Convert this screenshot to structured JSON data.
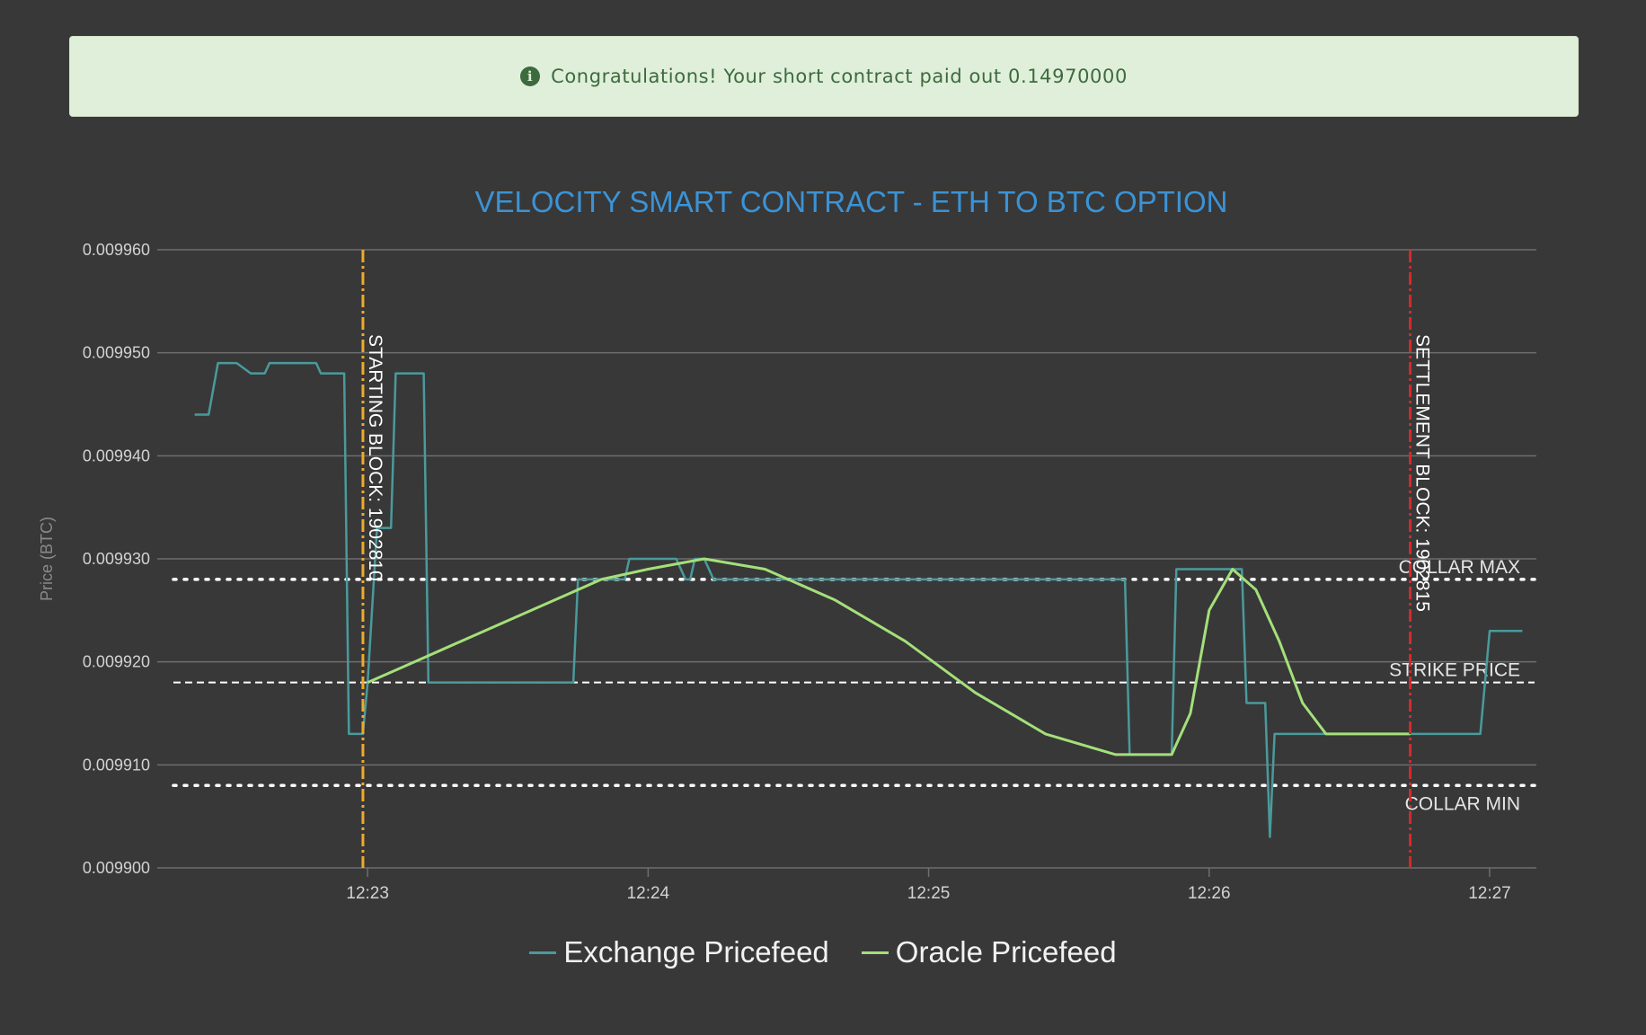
{
  "alert": {
    "icon": "info-icon",
    "message": "Congratulations! Your short contract paid out 0.14970000",
    "text_color": "#3c6b3e",
    "background": "#e0efda"
  },
  "chart_data": {
    "type": "line",
    "title": "VELOCITY SMART CONTRACT - ETH TO BTC OPTION",
    "xlabel": "",
    "ylabel": "Price (BTC)",
    "ylim": [
      0.0099,
      0.00996
    ],
    "xlim": [
      "12:22:15",
      "12:27:10"
    ],
    "y_ticks": [
      "0.009900",
      "0.009910",
      "0.009920",
      "0.009930",
      "0.009940",
      "0.009950",
      "0.009960"
    ],
    "x_ticks": [
      "12:23",
      "12:24",
      "12:25",
      "12:26",
      "12:27"
    ],
    "grid": true,
    "legend_position": "bottom",
    "series": [
      {
        "name": "Exchange Pricefeed",
        "color": "#4a9a9c",
        "points": [
          [
            "12:22:23",
            0.009944
          ],
          [
            "12:22:26",
            0.009944
          ],
          [
            "12:22:28",
            0.009949
          ],
          [
            "12:22:32",
            0.009949
          ],
          [
            "12:22:35",
            0.009948
          ],
          [
            "12:22:38",
            0.009948
          ],
          [
            "12:22:39",
            0.009949
          ],
          [
            "12:22:49",
            0.009949
          ],
          [
            "12:22:50",
            0.009948
          ],
          [
            "12:22:55",
            0.009948
          ],
          [
            "12:22:56",
            0.009913
          ],
          [
            "12:22:59",
            0.009913
          ],
          [
            "12:23:00",
            0.009918
          ],
          [
            "12:23:02",
            0.009933
          ],
          [
            "12:23:05",
            0.009933
          ],
          [
            "12:23:06",
            0.009948
          ],
          [
            "12:23:12",
            0.009948
          ],
          [
            "12:23:13",
            0.009918
          ],
          [
            "12:23:44",
            0.009918
          ],
          [
            "12:23:45",
            0.009928
          ],
          [
            "12:23:55",
            0.009928
          ],
          [
            "12:23:56",
            0.00993
          ],
          [
            "12:24:06",
            0.00993
          ],
          [
            "12:24:08",
            0.009928
          ],
          [
            "12:24:09",
            0.009928
          ],
          [
            "12:24:10",
            0.00993
          ],
          [
            "12:24:12",
            0.00993
          ],
          [
            "12:24:14",
            0.009928
          ],
          [
            "12:25:42",
            0.009928
          ],
          [
            "12:25:43",
            0.009911
          ],
          [
            "12:25:52",
            0.009911
          ],
          [
            "12:25:53",
            0.009929
          ],
          [
            "12:26:07",
            0.009929
          ],
          [
            "12:26:08",
            0.009916
          ],
          [
            "12:26:12",
            0.009916
          ],
          [
            "12:26:13",
            0.009903
          ],
          [
            "12:26:14",
            0.009913
          ],
          [
            "12:26:58",
            0.009913
          ],
          [
            "12:27:00",
            0.009923
          ],
          [
            "12:27:07",
            0.009923
          ]
        ]
      },
      {
        "name": "Oracle Pricefeed",
        "color": "#a4e07a",
        "points": [
          [
            "12:23:00",
            0.009918
          ],
          [
            "12:23:10",
            0.00992
          ],
          [
            "12:23:20",
            0.009922
          ],
          [
            "12:23:30",
            0.009924
          ],
          [
            "12:23:40",
            0.009926
          ],
          [
            "12:23:50",
            0.009928
          ],
          [
            "12:24:00",
            0.009929
          ],
          [
            "12:24:12",
            0.00993
          ],
          [
            "12:24:25",
            0.009929
          ],
          [
            "12:24:40",
            0.009926
          ],
          [
            "12:24:55",
            0.009922
          ],
          [
            "12:25:10",
            0.009917
          ],
          [
            "12:25:25",
            0.009913
          ],
          [
            "12:25:40",
            0.009911
          ],
          [
            "12:25:52",
            0.009911
          ],
          [
            "12:25:56",
            0.009915
          ],
          [
            "12:26:00",
            0.009925
          ],
          [
            "12:26:05",
            0.009929
          ],
          [
            "12:26:10",
            0.009927
          ],
          [
            "12:26:15",
            0.009922
          ],
          [
            "12:26:20",
            0.009916
          ],
          [
            "12:26:25",
            0.009913
          ],
          [
            "12:26:35",
            0.009913
          ],
          [
            "12:26:43",
            0.009913
          ]
        ]
      }
    ],
    "horizontal_lines": [
      {
        "label": "COLLAR MAX",
        "value": 0.009928,
        "style": "dotted",
        "color": "#ffffff"
      },
      {
        "label": "STRIKE PRICE",
        "value": 0.009918,
        "style": "dashed",
        "color": "#ffffff"
      },
      {
        "label": "COLLAR MIN",
        "value": 0.009908,
        "style": "dotted",
        "color": "#ffffff"
      }
    ],
    "vertical_lines": [
      {
        "label": "STARTING BLOCK: 1902810",
        "x": "12:22:59",
        "color": "#f0a92a"
      },
      {
        "label": "SETTLEMENT BLOCK: 1902815",
        "x": "12:26:43",
        "color": "#d42a2a"
      }
    ]
  }
}
